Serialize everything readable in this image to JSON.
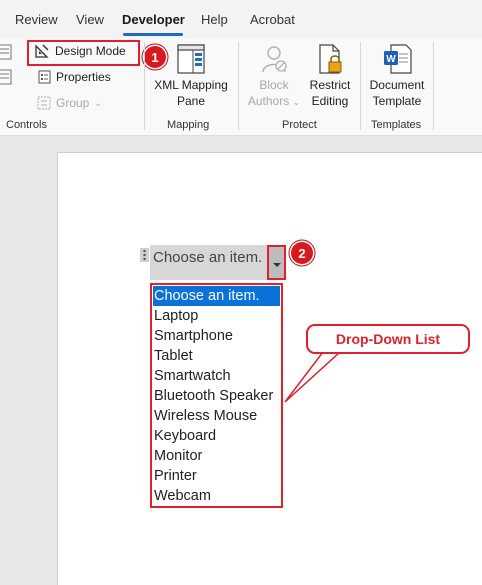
{
  "tabs": [
    {
      "label": "Review"
    },
    {
      "label": "View"
    },
    {
      "label": "Developer"
    },
    {
      "label": "Help"
    },
    {
      "label": "Acrobat"
    }
  ],
  "active_tab": "Developer",
  "ribbon": {
    "controls": {
      "design_mode": "Design Mode",
      "properties": "Properties",
      "group": "Group",
      "label": "Controls"
    },
    "mapping": {
      "xml_line1": "XML Mapping",
      "xml_line2": "Pane",
      "label": "Mapping"
    },
    "protect": {
      "block_line1": "Block",
      "block_line2": "Authors",
      "restrict_line1": "Restrict",
      "restrict_line2": "Editing",
      "label": "Protect"
    },
    "templates": {
      "doc_line1": "Document",
      "doc_line2": "Template",
      "label": "Templates"
    }
  },
  "badges": {
    "one": "1",
    "two": "2"
  },
  "content_control": {
    "placeholder": "Choose an item."
  },
  "dropdown": {
    "items": [
      "Choose an item.",
      "Laptop",
      "Smartphone",
      "Tablet",
      "Smartwatch",
      "Bluetooth Speaker",
      "Wireless Mouse",
      "Keyboard",
      "Monitor",
      "Printer",
      "Webcam"
    ],
    "selected_index": 0
  },
  "callout": {
    "label": "Drop-Down List"
  },
  "colors": {
    "accent_red": "#e0202a",
    "selection_blue": "#0a72d8",
    "tab_underline": "#1e6bc1"
  }
}
